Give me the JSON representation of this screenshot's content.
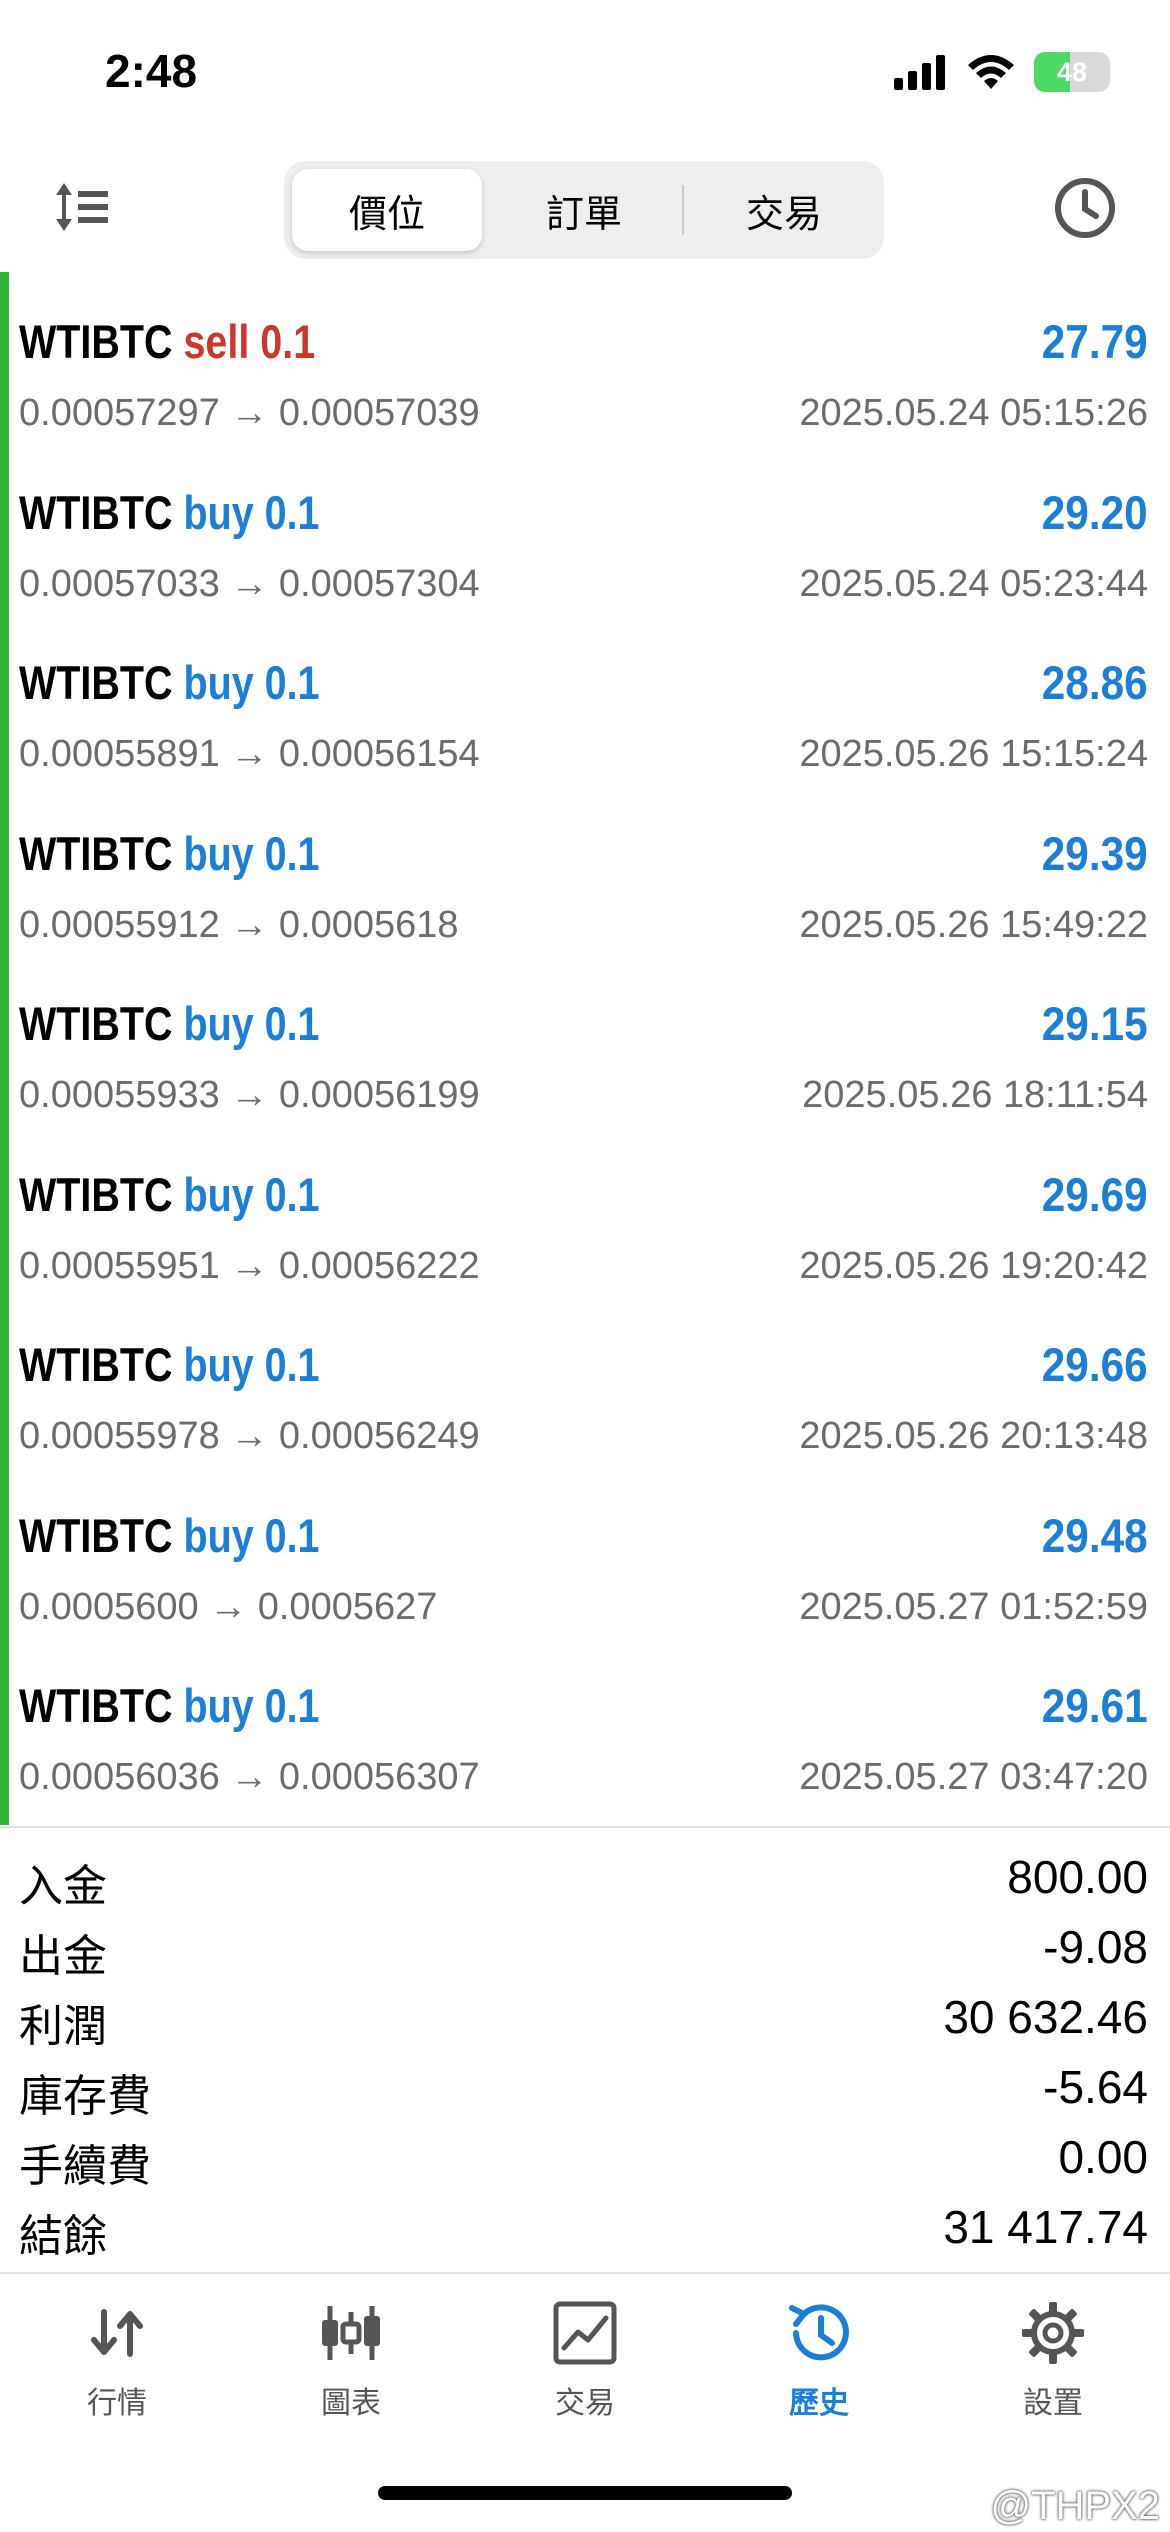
{
  "status_bar": {
    "time": "2:48",
    "battery": "48"
  },
  "header": {
    "tabs": [
      {
        "label": "價位",
        "active": true
      },
      {
        "label": "訂單",
        "active": false
      },
      {
        "label": "交易",
        "active": false
      }
    ]
  },
  "deals": [
    {
      "symbol": "WTIBTC",
      "type": "sell 0.1",
      "profit": "27.79",
      "prices": "0.00057297 → 0.00057039",
      "time": "2025.05.24 05:15:26"
    },
    {
      "symbol": "WTIBTC",
      "type": "buy 0.1",
      "profit": "29.20",
      "prices": "0.00057033 → 0.00057304",
      "time": "2025.05.24 05:23:44"
    },
    {
      "symbol": "WTIBTC",
      "type": "buy 0.1",
      "profit": "28.86",
      "prices": "0.00055891 → 0.00056154",
      "time": "2025.05.26 15:15:24"
    },
    {
      "symbol": "WTIBTC",
      "type": "buy 0.1",
      "profit": "29.39",
      "prices": "0.00055912 → 0.0005618",
      "time": "2025.05.26 15:49:22"
    },
    {
      "symbol": "WTIBTC",
      "type": "buy 0.1",
      "profit": "29.15",
      "prices": "0.00055933 → 0.00056199",
      "time": "2025.05.26 18:11:54"
    },
    {
      "symbol": "WTIBTC",
      "type": "buy 0.1",
      "profit": "29.69",
      "prices": "0.00055951 → 0.00056222",
      "time": "2025.05.26 19:20:42"
    },
    {
      "symbol": "WTIBTC",
      "type": "buy 0.1",
      "profit": "29.66",
      "prices": "0.00055978 → 0.00056249",
      "time": "2025.05.26 20:13:48"
    },
    {
      "symbol": "WTIBTC",
      "type": "buy 0.1",
      "profit": "29.48",
      "prices": "0.0005600 → 0.0005627",
      "time": "2025.05.27 01:52:59"
    },
    {
      "symbol": "WTIBTC",
      "type": "buy 0.1",
      "profit": "29.61",
      "prices": "0.00056036 → 0.00056307",
      "time": "2025.05.27 03:47:20"
    }
  ],
  "summary": [
    {
      "label": "入金",
      "value": "800.00"
    },
    {
      "label": "出金",
      "value": "-9.08"
    },
    {
      "label": "利潤",
      "value": "30 632.46"
    },
    {
      "label": "庫存費",
      "value": "-5.64"
    },
    {
      "label": "手續費",
      "value": "0.00"
    },
    {
      "label": "結餘",
      "value": "31 417.74"
    }
  ],
  "tabbar": [
    {
      "label": "行情",
      "icon": "quotes-arrows-icon",
      "active": false
    },
    {
      "label": "圖表",
      "icon": "chart-candles-icon",
      "active": false
    },
    {
      "label": "交易",
      "icon": "trade-chart-icon",
      "active": false
    },
    {
      "label": "歷史",
      "icon": "history-clock-icon",
      "active": true
    },
    {
      "label": "設置",
      "icon": "gear-icon",
      "active": false
    }
  ],
  "watermark": "@THPX2",
  "colors": {
    "sell": "#c9382a",
    "buy": "#1b7fd8",
    "accent": "#2db432"
  }
}
